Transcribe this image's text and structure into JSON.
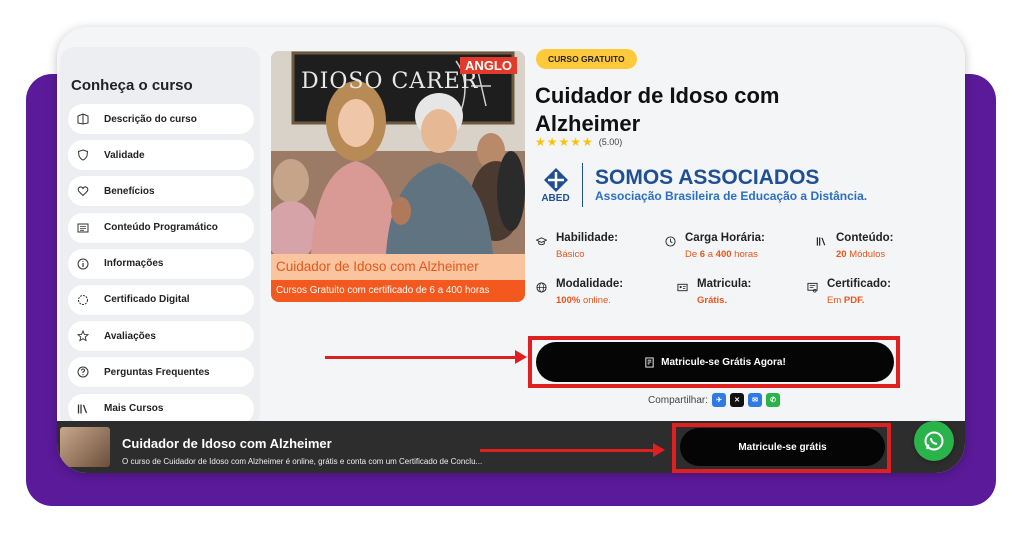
{
  "sidebar": {
    "title": "Conheça o curso",
    "items": [
      {
        "label": "Descrição do curso",
        "icon": "book-icon"
      },
      {
        "label": "Validade",
        "icon": "shield-icon"
      },
      {
        "label": "Benefícios",
        "icon": "heart-icon"
      },
      {
        "label": "Conteúdo Programático",
        "icon": "list-icon"
      },
      {
        "label": "Informações",
        "icon": "info-icon"
      },
      {
        "label": "Certificado Digital",
        "icon": "certificate-icon"
      },
      {
        "label": "Avaliações",
        "icon": "star-icon"
      },
      {
        "label": "Perguntas Frequentes",
        "icon": "question-icon"
      },
      {
        "label": "Mais Cursos",
        "icon": "books-icon"
      }
    ]
  },
  "hero": {
    "board_text": "DIOSO CARER",
    "brand": "ANGLO",
    "caption_title": "Cuidador de Idoso com Alzheimer",
    "caption_sub": "Cursos Gratuito com certificado de 6 a 400 horas"
  },
  "course": {
    "badge": "CURSO GRATUITO",
    "title": "Cuidador de Idoso com Alzheimer",
    "stars": "★★★★★",
    "rating": "(5.00)"
  },
  "abed": {
    "logo_word": "ABED",
    "main": "SOMOS ASSOCIADOS",
    "sub": "Associação Brasileira de Educação a Distância."
  },
  "info": {
    "habilidade": {
      "label": "Habilidade:",
      "value": "Básico"
    },
    "carga": {
      "label": "Carga Horária:",
      "pre": "De ",
      "a": "6",
      "mid": " a ",
      "b": "400",
      "post": " horas"
    },
    "conteudo": {
      "label": "Conteúdo:",
      "num": "20",
      "post": " Módulos"
    },
    "modalidade": {
      "label": "Modalidade:",
      "num": "100%",
      "post": " online."
    },
    "matricula": {
      "label": "Matricula:",
      "value": "Grátis."
    },
    "certificado": {
      "label": "Certificado:",
      "pre": "Em ",
      "value": "PDF."
    }
  },
  "cta": {
    "label": "Matricule-se Grátis Agora!"
  },
  "share": {
    "label": "Compartilhar:"
  },
  "bottom_bar": {
    "title": "Cuidador de Idoso com Alzheimer",
    "desc": "O curso de Cuidador de Idoso com Alzheimer é online, grátis e conta com um Certificado de Conclu...",
    "button": "Matricule-se grátis"
  },
  "colors": {
    "accent": "#e8551d",
    "purple": "#5b1a99",
    "badge": "#ffc93c",
    "abed": "#1f4f95",
    "whatsapp": "#2bb34b"
  }
}
